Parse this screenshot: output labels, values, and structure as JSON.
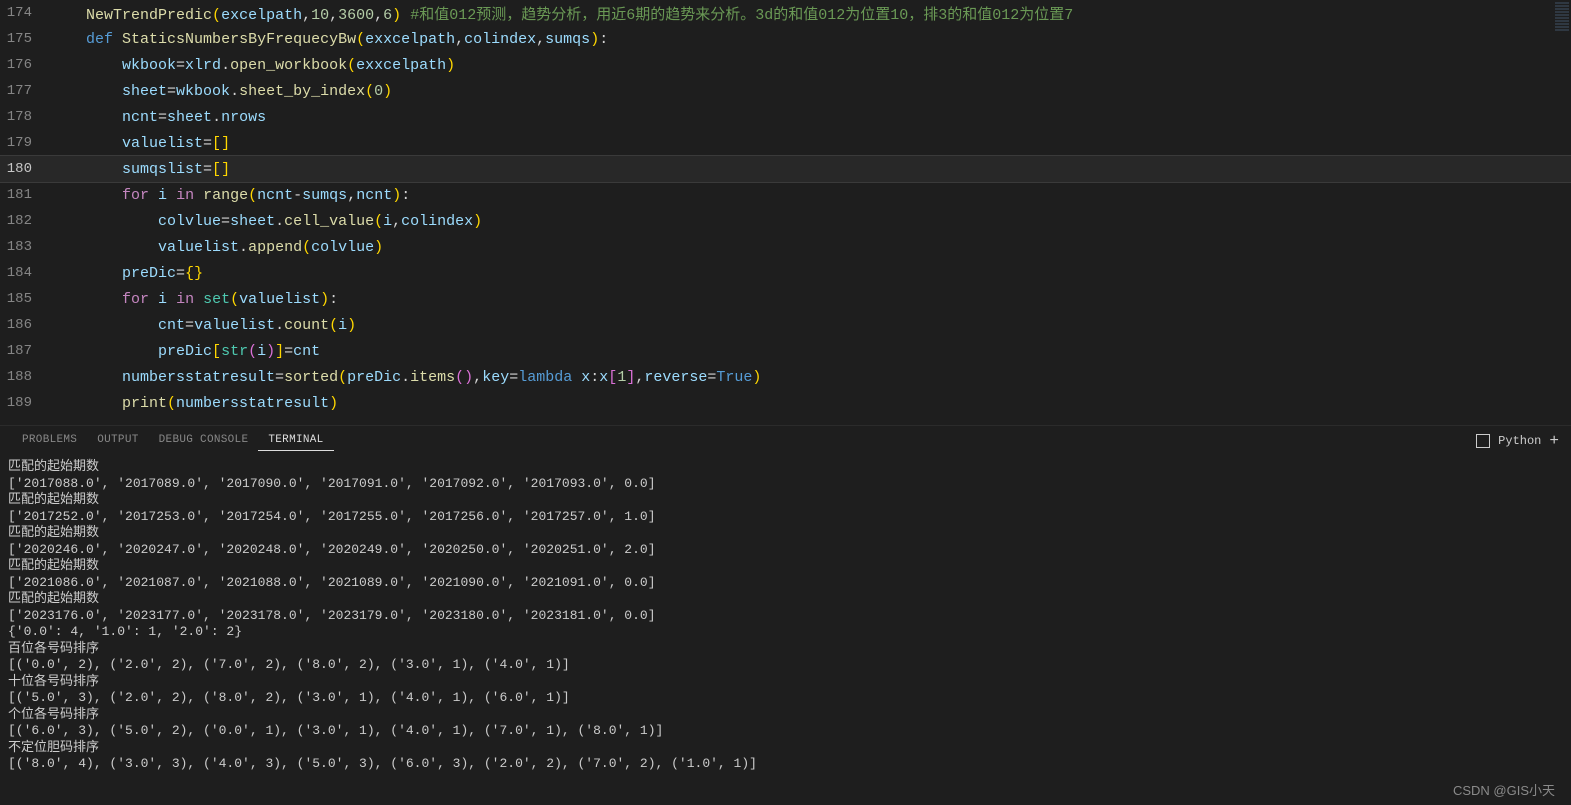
{
  "editor": {
    "lines": [
      {
        "num": "174",
        "active": false,
        "highlighted": false,
        "tokens": [
          {
            "t": "    ",
            "c": "tok-punct"
          },
          {
            "t": "NewTrendPredic",
            "c": "tok-function"
          },
          {
            "t": "(",
            "c": "tok-bracket1"
          },
          {
            "t": "excelpath",
            "c": "tok-variable"
          },
          {
            "t": ",",
            "c": "tok-punct"
          },
          {
            "t": "10",
            "c": "tok-number"
          },
          {
            "t": ",",
            "c": "tok-punct"
          },
          {
            "t": "3600",
            "c": "tok-number"
          },
          {
            "t": ",",
            "c": "tok-punct"
          },
          {
            "t": "6",
            "c": "tok-number"
          },
          {
            "t": ")",
            "c": "tok-bracket1"
          },
          {
            "t": " ",
            "c": "tok-punct"
          },
          {
            "t": "#和值012预测，趋势分析，用近6期的趋势来分析。3d的和值012为位置10，排3的和值012为位置7",
            "c": "tok-comment"
          }
        ]
      },
      {
        "num": "175",
        "active": false,
        "highlighted": false,
        "tokens": [
          {
            "t": "    ",
            "c": "tok-punct"
          },
          {
            "t": "def",
            "c": "tok-keyword"
          },
          {
            "t": " ",
            "c": "tok-punct"
          },
          {
            "t": "StaticsNumbersByFrequecyBw",
            "c": "tok-function"
          },
          {
            "t": "(",
            "c": "tok-bracket1"
          },
          {
            "t": "exxcelpath",
            "c": "tok-param"
          },
          {
            "t": ",",
            "c": "tok-punct"
          },
          {
            "t": "colindex",
            "c": "tok-param"
          },
          {
            "t": ",",
            "c": "tok-punct"
          },
          {
            "t": "sumqs",
            "c": "tok-param"
          },
          {
            "t": ")",
            "c": "tok-bracket1"
          },
          {
            "t": ":",
            "c": "tok-punct"
          }
        ]
      },
      {
        "num": "176",
        "active": false,
        "highlighted": false,
        "tokens": [
          {
            "t": "        ",
            "c": "tok-punct"
          },
          {
            "t": "wkbook",
            "c": "tok-variable"
          },
          {
            "t": "=",
            "c": "tok-operator"
          },
          {
            "t": "xlrd",
            "c": "tok-variable"
          },
          {
            "t": ".",
            "c": "tok-punct"
          },
          {
            "t": "open_workbook",
            "c": "tok-function"
          },
          {
            "t": "(",
            "c": "tok-bracket1"
          },
          {
            "t": "exxcelpath",
            "c": "tok-variable"
          },
          {
            "t": ")",
            "c": "tok-bracket1"
          }
        ]
      },
      {
        "num": "177",
        "active": false,
        "highlighted": false,
        "tokens": [
          {
            "t": "        ",
            "c": "tok-punct"
          },
          {
            "t": "sheet",
            "c": "tok-variable"
          },
          {
            "t": "=",
            "c": "tok-operator"
          },
          {
            "t": "wkbook",
            "c": "tok-variable"
          },
          {
            "t": ".",
            "c": "tok-punct"
          },
          {
            "t": "sheet_by_index",
            "c": "tok-function"
          },
          {
            "t": "(",
            "c": "tok-bracket1"
          },
          {
            "t": "0",
            "c": "tok-number"
          },
          {
            "t": ")",
            "c": "tok-bracket1"
          }
        ]
      },
      {
        "num": "178",
        "active": false,
        "highlighted": false,
        "tokens": [
          {
            "t": "        ",
            "c": "tok-punct"
          },
          {
            "t": "ncnt",
            "c": "tok-variable"
          },
          {
            "t": "=",
            "c": "tok-operator"
          },
          {
            "t": "sheet",
            "c": "tok-variable"
          },
          {
            "t": ".",
            "c": "tok-punct"
          },
          {
            "t": "nrows",
            "c": "tok-variable"
          }
        ]
      },
      {
        "num": "179",
        "active": false,
        "highlighted": false,
        "tokens": [
          {
            "t": "        ",
            "c": "tok-punct"
          },
          {
            "t": "valuelist",
            "c": "tok-variable"
          },
          {
            "t": "=",
            "c": "tok-operator"
          },
          {
            "t": "[",
            "c": "tok-bracket1"
          },
          {
            "t": "]",
            "c": "tok-bracket1"
          }
        ]
      },
      {
        "num": "180",
        "active": true,
        "highlighted": true,
        "tokens": [
          {
            "t": "        ",
            "c": "tok-punct"
          },
          {
            "t": "sumqslist",
            "c": "tok-variable"
          },
          {
            "t": "=",
            "c": "tok-operator"
          },
          {
            "t": "[",
            "c": "tok-bracket1"
          },
          {
            "t": "]",
            "c": "tok-bracket1"
          }
        ]
      },
      {
        "num": "181",
        "active": false,
        "highlighted": false,
        "tokens": [
          {
            "t": "        ",
            "c": "tok-punct"
          },
          {
            "t": "for",
            "c": "tok-control"
          },
          {
            "t": " ",
            "c": "tok-punct"
          },
          {
            "t": "i",
            "c": "tok-variable"
          },
          {
            "t": " ",
            "c": "tok-punct"
          },
          {
            "t": "in",
            "c": "tok-control"
          },
          {
            "t": " ",
            "c": "tok-punct"
          },
          {
            "t": "range",
            "c": "tok-function"
          },
          {
            "t": "(",
            "c": "tok-bracket1"
          },
          {
            "t": "ncnt",
            "c": "tok-variable"
          },
          {
            "t": "-",
            "c": "tok-operator"
          },
          {
            "t": "sumqs",
            "c": "tok-variable"
          },
          {
            "t": ",",
            "c": "tok-punct"
          },
          {
            "t": "ncnt",
            "c": "tok-variable"
          },
          {
            "t": ")",
            "c": "tok-bracket1"
          },
          {
            "t": ":",
            "c": "tok-punct"
          }
        ]
      },
      {
        "num": "182",
        "active": false,
        "highlighted": false,
        "tokens": [
          {
            "t": "            ",
            "c": "tok-punct"
          },
          {
            "t": "colvlue",
            "c": "tok-variable"
          },
          {
            "t": "=",
            "c": "tok-operator"
          },
          {
            "t": "sheet",
            "c": "tok-variable"
          },
          {
            "t": ".",
            "c": "tok-punct"
          },
          {
            "t": "cell_value",
            "c": "tok-function"
          },
          {
            "t": "(",
            "c": "tok-bracket1"
          },
          {
            "t": "i",
            "c": "tok-variable"
          },
          {
            "t": ",",
            "c": "tok-punct"
          },
          {
            "t": "colindex",
            "c": "tok-variable"
          },
          {
            "t": ")",
            "c": "tok-bracket1"
          }
        ]
      },
      {
        "num": "183",
        "active": false,
        "highlighted": false,
        "tokens": [
          {
            "t": "            ",
            "c": "tok-punct"
          },
          {
            "t": "valuelist",
            "c": "tok-variable"
          },
          {
            "t": ".",
            "c": "tok-punct"
          },
          {
            "t": "append",
            "c": "tok-function"
          },
          {
            "t": "(",
            "c": "tok-bracket1"
          },
          {
            "t": "colvlue",
            "c": "tok-variable"
          },
          {
            "t": ")",
            "c": "tok-bracket1"
          }
        ]
      },
      {
        "num": "184",
        "active": false,
        "highlighted": false,
        "tokens": [
          {
            "t": "        ",
            "c": "tok-punct"
          },
          {
            "t": "preDic",
            "c": "tok-variable"
          },
          {
            "t": "=",
            "c": "tok-operator"
          },
          {
            "t": "{",
            "c": "tok-bracket1"
          },
          {
            "t": "}",
            "c": "tok-bracket1"
          }
        ]
      },
      {
        "num": "185",
        "active": false,
        "highlighted": false,
        "tokens": [
          {
            "t": "        ",
            "c": "tok-punct"
          },
          {
            "t": "for",
            "c": "tok-control"
          },
          {
            "t": " ",
            "c": "tok-punct"
          },
          {
            "t": "i",
            "c": "tok-variable"
          },
          {
            "t": " ",
            "c": "tok-punct"
          },
          {
            "t": "in",
            "c": "tok-control"
          },
          {
            "t": " ",
            "c": "tok-punct"
          },
          {
            "t": "set",
            "c": "tok-type"
          },
          {
            "t": "(",
            "c": "tok-bracket1"
          },
          {
            "t": "valuelist",
            "c": "tok-variable"
          },
          {
            "t": ")",
            "c": "tok-bracket1"
          },
          {
            "t": ":",
            "c": "tok-punct"
          }
        ]
      },
      {
        "num": "186",
        "active": false,
        "highlighted": false,
        "tokens": [
          {
            "t": "            ",
            "c": "tok-punct"
          },
          {
            "t": "cnt",
            "c": "tok-variable"
          },
          {
            "t": "=",
            "c": "tok-operator"
          },
          {
            "t": "valuelist",
            "c": "tok-variable"
          },
          {
            "t": ".",
            "c": "tok-punct"
          },
          {
            "t": "count",
            "c": "tok-function"
          },
          {
            "t": "(",
            "c": "tok-bracket1"
          },
          {
            "t": "i",
            "c": "tok-variable"
          },
          {
            "t": ")",
            "c": "tok-bracket1"
          }
        ]
      },
      {
        "num": "187",
        "active": false,
        "highlighted": false,
        "tokens": [
          {
            "t": "            ",
            "c": "tok-punct"
          },
          {
            "t": "preDic",
            "c": "tok-variable"
          },
          {
            "t": "[",
            "c": "tok-bracket1"
          },
          {
            "t": "str",
            "c": "tok-type"
          },
          {
            "t": "(",
            "c": "tok-bracket2"
          },
          {
            "t": "i",
            "c": "tok-variable"
          },
          {
            "t": ")",
            "c": "tok-bracket2"
          },
          {
            "t": "]",
            "c": "tok-bracket1"
          },
          {
            "t": "=",
            "c": "tok-operator"
          },
          {
            "t": "cnt",
            "c": "tok-variable"
          }
        ]
      },
      {
        "num": "188",
        "active": false,
        "highlighted": false,
        "tokens": [
          {
            "t": "        ",
            "c": "tok-punct"
          },
          {
            "t": "numbersstatresult",
            "c": "tok-variable"
          },
          {
            "t": "=",
            "c": "tok-operator"
          },
          {
            "t": "sorted",
            "c": "tok-function"
          },
          {
            "t": "(",
            "c": "tok-bracket1"
          },
          {
            "t": "preDic",
            "c": "tok-variable"
          },
          {
            "t": ".",
            "c": "tok-punct"
          },
          {
            "t": "items",
            "c": "tok-function"
          },
          {
            "t": "(",
            "c": "tok-bracket2"
          },
          {
            "t": ")",
            "c": "tok-bracket2"
          },
          {
            "t": ",",
            "c": "tok-punct"
          },
          {
            "t": "key",
            "c": "tok-variable"
          },
          {
            "t": "=",
            "c": "tok-operator"
          },
          {
            "t": "lambda",
            "c": "tok-keyword"
          },
          {
            "t": " ",
            "c": "tok-punct"
          },
          {
            "t": "x",
            "c": "tok-variable"
          },
          {
            "t": ":",
            "c": "tok-punct"
          },
          {
            "t": "x",
            "c": "tok-variable"
          },
          {
            "t": "[",
            "c": "tok-bracket2"
          },
          {
            "t": "1",
            "c": "tok-number"
          },
          {
            "t": "]",
            "c": "tok-bracket2"
          },
          {
            "t": ",",
            "c": "tok-punct"
          },
          {
            "t": "reverse",
            "c": "tok-variable"
          },
          {
            "t": "=",
            "c": "tok-operator"
          },
          {
            "t": "True",
            "c": "tok-bool"
          },
          {
            "t": ")",
            "c": "tok-bracket1"
          }
        ]
      },
      {
        "num": "189",
        "active": false,
        "highlighted": false,
        "tokens": [
          {
            "t": "        ",
            "c": "tok-punct"
          },
          {
            "t": "print",
            "c": "tok-function"
          },
          {
            "t": "(",
            "c": "tok-bracket1"
          },
          {
            "t": "numbersstatresult",
            "c": "tok-variable"
          },
          {
            "t": ")",
            "c": "tok-bracket1"
          }
        ]
      }
    ]
  },
  "panel": {
    "tabs": [
      {
        "label": "PROBLEMS",
        "active": false
      },
      {
        "label": "OUTPUT",
        "active": false
      },
      {
        "label": "DEBUG CONSOLE",
        "active": false
      },
      {
        "label": "TERMINAL",
        "active": true
      }
    ],
    "right_label": "Python",
    "plus": "+"
  },
  "terminal": {
    "lines": [
      "匹配的起始期数",
      "['2017088.0', '2017089.0', '2017090.0', '2017091.0', '2017092.0', '2017093.0', 0.0]",
      "匹配的起始期数",
      "['2017252.0', '2017253.0', '2017254.0', '2017255.0', '2017256.0', '2017257.0', 1.0]",
      "匹配的起始期数",
      "['2020246.0', '2020247.0', '2020248.0', '2020249.0', '2020250.0', '2020251.0', 2.0]",
      "匹配的起始期数",
      "['2021086.0', '2021087.0', '2021088.0', '2021089.0', '2021090.0', '2021091.0', 0.0]",
      "匹配的起始期数",
      "['2023176.0', '2023177.0', '2023178.0', '2023179.0', '2023180.0', '2023181.0', 0.0]",
      "{'0.0': 4, '1.0': 1, '2.0': 2}",
      "百位各号码排序",
      "[('0.0', 2), ('2.0', 2), ('7.0', 2), ('8.0', 2), ('3.0', 1), ('4.0', 1)]",
      "十位各号码排序",
      "[('5.0', 3), ('2.0', 2), ('8.0', 2), ('3.0', 1), ('4.0', 1), ('6.0', 1)]",
      "个位各号码排序",
      "[('6.0', 3), ('5.0', 2), ('0.0', 1), ('3.0', 1), ('4.0', 1), ('7.0', 1), ('8.0', 1)]",
      "不定位胆码排序",
      "[('8.0', 4), ('3.0', 3), ('4.0', 3), ('5.0', 3), ('6.0', 3), ('2.0', 2), ('7.0', 2), ('1.0', 1)]"
    ]
  },
  "watermark": "CSDN @GIS小天"
}
